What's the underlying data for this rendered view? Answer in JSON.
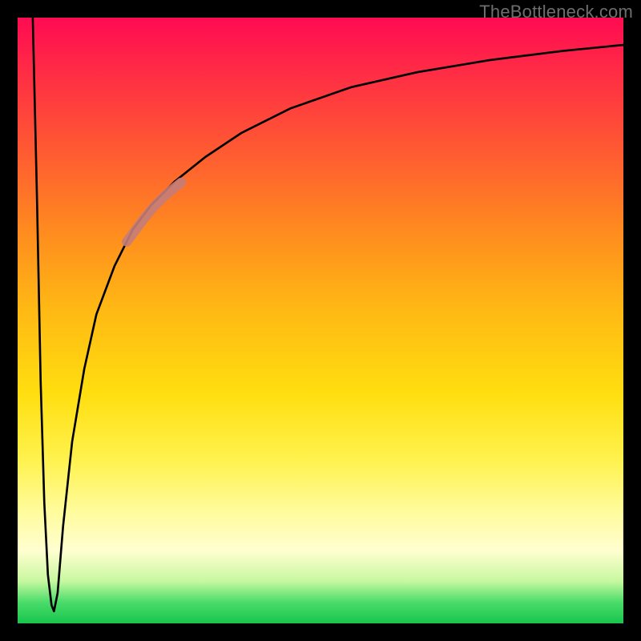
{
  "watermark": "TheBottleneck.com",
  "chart_data": {
    "type": "line",
    "title": "",
    "xlabel": "",
    "ylabel": "",
    "xlim": [
      0,
      100
    ],
    "ylim": [
      0,
      100
    ],
    "grid": false,
    "legend": false,
    "series": [
      {
        "name": "curve",
        "color": "#000000",
        "x": [
          2.5,
          3.2,
          3.8,
          4.4,
          5.0,
          5.6,
          6.0,
          6.6,
          7.5,
          9.0,
          11,
          13,
          16,
          19,
          22,
          26,
          31,
          37,
          45,
          55,
          66,
          78,
          90,
          100
        ],
        "y": [
          100,
          70,
          40,
          20,
          8,
          3,
          2,
          5,
          16,
          30,
          42,
          51,
          59,
          65,
          69,
          73,
          77,
          81,
          85,
          88.5,
          91,
          93,
          94.5,
          95.5
        ]
      },
      {
        "name": "highlight-segment",
        "color": "#c47d79",
        "x": [
          18,
          19.5,
          21,
          22.5,
          24,
          25.5,
          27
        ],
        "y": [
          63,
          65,
          67,
          68.8,
          70.3,
          71.6,
          72.8
        ]
      }
    ],
    "background_gradient": {
      "orientation": "vertical",
      "stops": [
        {
          "pos": 0,
          "color": "#ff0b52"
        },
        {
          "pos": 0.35,
          "color": "#ff8a1f"
        },
        {
          "pos": 0.62,
          "color": "#ffde0f"
        },
        {
          "pos": 0.88,
          "color": "#fffed0"
        },
        {
          "pos": 0.97,
          "color": "#4bdc6a"
        },
        {
          "pos": 1.0,
          "color": "#17c54e"
        }
      ]
    }
  }
}
